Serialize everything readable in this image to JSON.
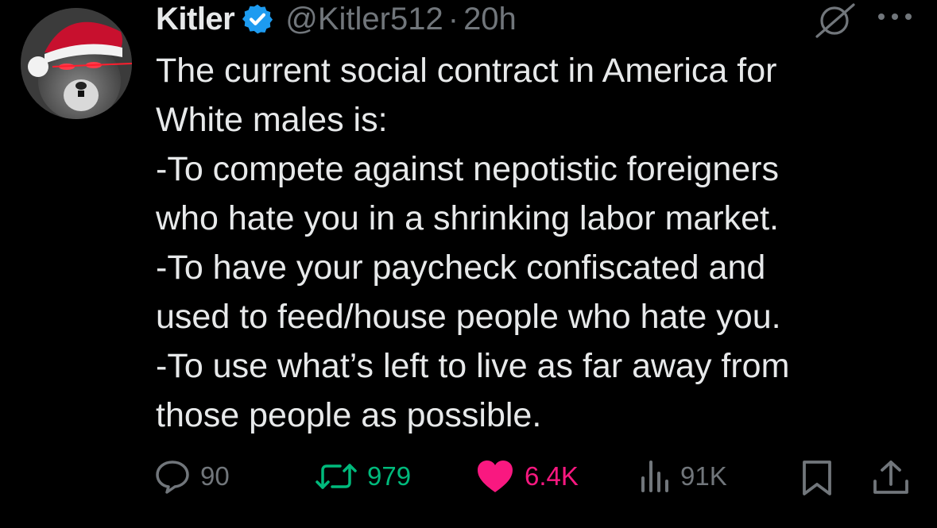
{
  "tweet": {
    "author_name": "Kitler",
    "handle": "@Kitler512",
    "separator": "·",
    "time": "20h",
    "text": "The current social contract in America for\nWhite males is:\n-To compete against nepotistic foreigners\nwho hate you in a shrinking labor market.\n-To have your paycheck confiscated and\nused to feed/house people who hate you.\n-To use what’s left to live as far away from\nthose people as possible."
  },
  "actions": {
    "replies": "90",
    "retweets": "979",
    "likes": "6.4K",
    "views": "91K"
  },
  "colors": {
    "background": "#000000",
    "text": "#e7e9ea",
    "muted": "#71767b",
    "verified": "#1d9bf0",
    "retweet": "#00ba7c",
    "like": "#f91880"
  },
  "icons": [
    "avatar",
    "verified-badge-icon",
    "grok-icon",
    "more-icon",
    "reply-icon",
    "retweet-icon",
    "heart-icon",
    "views-icon",
    "bookmark-icon",
    "share-icon"
  ]
}
